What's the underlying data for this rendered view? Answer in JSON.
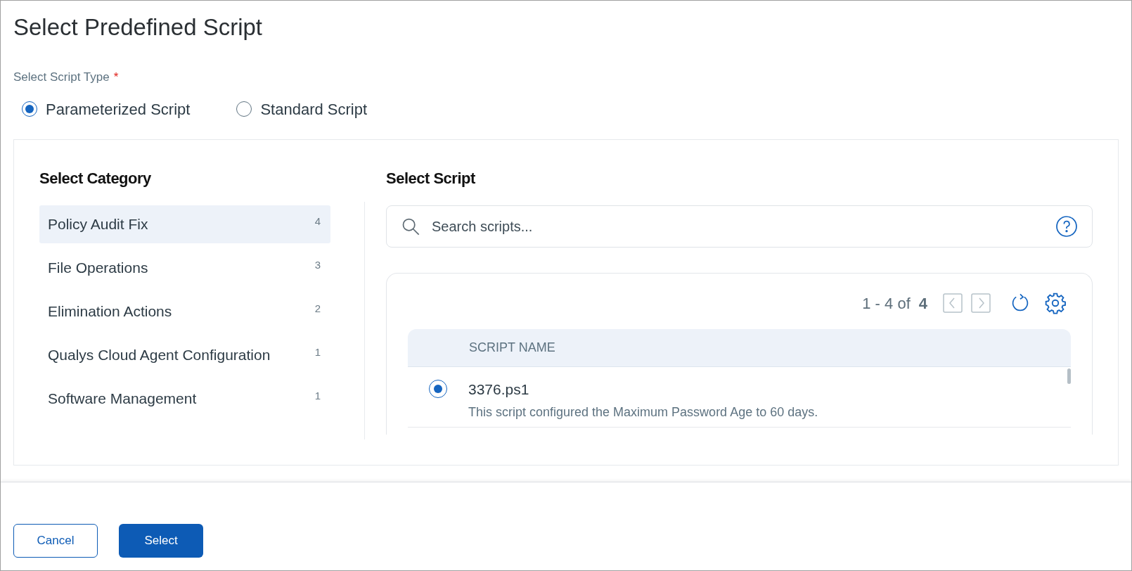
{
  "title": "Select Predefined Script",
  "script_type": {
    "label": "Select Script Type",
    "required_mark": "*",
    "options": [
      {
        "label": "Parameterized Script",
        "selected": true
      },
      {
        "label": "Standard Script",
        "selected": false
      }
    ]
  },
  "categories": {
    "heading": "Select Category",
    "items": [
      {
        "label": "Policy Audit Fix",
        "count": "4",
        "selected": true
      },
      {
        "label": "File Operations",
        "count": "3",
        "selected": false
      },
      {
        "label": "Elimination Actions",
        "count": "2",
        "selected": false
      },
      {
        "label": "Qualys Cloud Agent Configuration",
        "count": "1",
        "selected": false
      },
      {
        "label": "Software Management",
        "count": "1",
        "selected": false
      }
    ]
  },
  "scripts": {
    "heading": "Select Script",
    "search": {
      "placeholder": "Search scripts..."
    },
    "pagination": {
      "range": "1 - 4 of",
      "total": "4"
    },
    "table": {
      "columns": [
        "SCRIPT NAME"
      ],
      "rows": [
        {
          "name": "3376.ps1",
          "description": "This script configured the Maximum Password Age to 60 days.",
          "selected": true
        }
      ]
    }
  },
  "buttons": [
    {
      "label": "Cancel",
      "kind": "secondary"
    },
    {
      "label": "Select",
      "kind": "primary"
    }
  ]
}
